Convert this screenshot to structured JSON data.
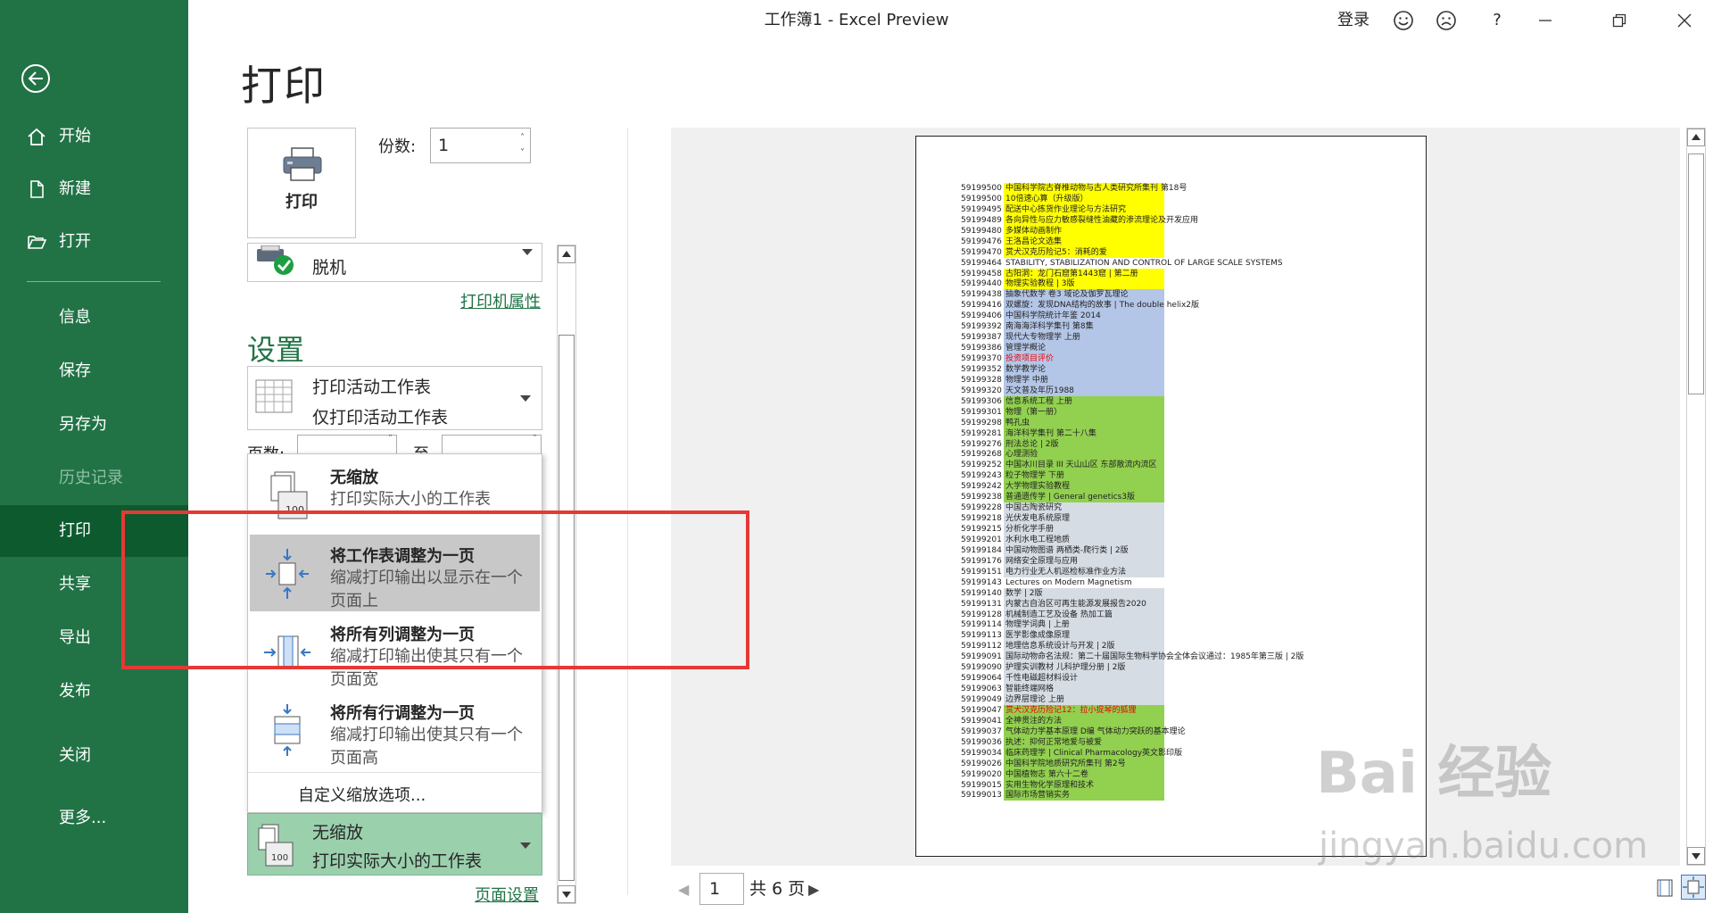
{
  "window": {
    "title": "工作簿1 -  Excel Preview",
    "login": "登录",
    "help": "?"
  },
  "nav": {
    "items": [
      {
        "label": "开始",
        "icon": "home-icon"
      },
      {
        "label": "新建",
        "icon": "new-document-icon"
      },
      {
        "label": "打开",
        "icon": "folder-open-icon"
      },
      {
        "label": "信息"
      },
      {
        "label": "保存"
      },
      {
        "label": "另存为"
      },
      {
        "label": "历史记录",
        "disabled": true
      },
      {
        "label": "打印",
        "active": true
      },
      {
        "label": "共享"
      },
      {
        "label": "导出"
      },
      {
        "label": "发布"
      },
      {
        "label": "关闭"
      },
      {
        "label": "更多..."
      }
    ]
  },
  "print": {
    "heading": "打印",
    "print_button": "打印",
    "copies_label": "份数:",
    "copies_value": "1",
    "printer_name": "脱机",
    "printer_properties": "打印机属性",
    "settings_heading": "设置",
    "what_to_print_title": "打印活动工作表",
    "what_to_print_desc": "仅打印活动工作表",
    "pages_label": "页数:",
    "to_label": "至",
    "scaling_options": [
      {
        "title": "无缩放",
        "desc": "打印实际大小的工作表",
        "icon": "no-scaling-icon"
      },
      {
        "title": "将工作表调整为一页",
        "desc": "缩减打印输出以显示在一个页面上",
        "icon": "fit-sheet-icon",
        "selected": true
      },
      {
        "title": "将所有列调整为一页",
        "desc": "缩减打印输出使其只有一个页面宽",
        "icon": "fit-columns-icon"
      },
      {
        "title": "将所有行调整为一页",
        "desc": "缩减打印输出使其只有一个页面高",
        "icon": "fit-rows-icon"
      }
    ],
    "custom_scaling": "自定义缩放选项...",
    "current_scaling_title": "无缩放",
    "current_scaling_desc": "打印实际大小的工作表",
    "page_setup": "页面设置"
  },
  "preview": {
    "current_page": "1",
    "total_pages": "共 6 页",
    "rows": [
      {
        "id": "59199500",
        "text": "中国科学院古脊椎动物与古人类研究所集刊 第18号",
        "c": "y",
        "red": true
      },
      {
        "id": "59199500",
        "text": "10倍速心算（升级版）",
        "c": "y",
        "red": true
      },
      {
        "id": "59199495",
        "text": "配送中心拣货作业理论与方法研究",
        "c": "y",
        "red": true
      },
      {
        "id": "59199489",
        "text": "各向异性与应力敏感裂缝性油藏的渗流理论及开发应用",
        "c": "y",
        "red": true
      },
      {
        "id": "59199480",
        "text": "多媒体动画制作",
        "c": "y",
        "red": true
      },
      {
        "id": "59199476",
        "text": "王洛昌论文选集",
        "c": "y",
        "red": true
      },
      {
        "id": "59199470",
        "text": "赏犬汉克历险记5：消耗的爱",
        "c": "y",
        "red": true
      },
      {
        "id": "59199464",
        "text": "STABILITY, STABILIZATION AND CONTROL OF LARGE SCALE SYSTEMS",
        "c": "w"
      },
      {
        "id": "59199458",
        "text": "古阳洞：龙门石窟第1443窟 | 第二册",
        "c": "y",
        "red": true
      },
      {
        "id": "59199440",
        "text": "物理实验教程 | 3版",
        "c": "y",
        "red": true
      },
      {
        "id": "59199438",
        "text": "抽象代数学 卷3 域论及伽罗瓦理论",
        "c": "b"
      },
      {
        "id": "59199416",
        "text": "双螺旋：发现DNA结构的故事 | The double helix2版",
        "c": "b"
      },
      {
        "id": "59199406",
        "text": "中国科学院统计年鉴 2014",
        "c": "b"
      },
      {
        "id": "59199392",
        "text": "南海海洋科学集刊 第8集",
        "c": "b"
      },
      {
        "id": "59199387",
        "text": "现代大专物理学 上册",
        "c": "b"
      },
      {
        "id": "59199386",
        "text": "管理学概论",
        "c": "b"
      },
      {
        "id": "59199370",
        "text": "投资项目评价",
        "c": "b",
        "red": true
      },
      {
        "id": "59199352",
        "text": "数学教学论",
        "c": "b"
      },
      {
        "id": "59199328",
        "text": "物理学 中册",
        "c": "b"
      },
      {
        "id": "59199320",
        "text": "天文普及年历1988",
        "c": "b"
      },
      {
        "id": "59199306",
        "text": "信息系统工程 上册",
        "c": "g"
      },
      {
        "id": "59199301",
        "text": "物理（第一册）",
        "c": "g"
      },
      {
        "id": "59199298",
        "text": "鸭孔虫",
        "c": "g"
      },
      {
        "id": "59199281",
        "text": "海洋科学集刊 第二十八集",
        "c": "g"
      },
      {
        "id": "59199276",
        "text": "刑法总论 | 2版",
        "c": "g"
      },
      {
        "id": "59199268",
        "text": "心理测验",
        "c": "g"
      },
      {
        "id": "59199252",
        "text": "中国冰川目录 III 天山山区 东部散流内流区",
        "c": "g"
      },
      {
        "id": "59199243",
        "text": "粒子物理学 下册",
        "c": "g"
      },
      {
        "id": "59199242",
        "text": "大学物理实验教程",
        "c": "g"
      },
      {
        "id": "59199238",
        "text": "普通遗传学 | General genetics3版",
        "c": "g"
      },
      {
        "id": "59199228",
        "text": "中国古陶瓷研究",
        "c": "s"
      },
      {
        "id": "59199218",
        "text": "光伏发电系统原理",
        "c": "s"
      },
      {
        "id": "59199215",
        "text": "分析化学手册",
        "c": "s"
      },
      {
        "id": "59199201",
        "text": "水利水电工程地质",
        "c": "s"
      },
      {
        "id": "59199184",
        "text": "中国动物图谱 两栖类-爬行类 | 2版",
        "c": "s"
      },
      {
        "id": "59199176",
        "text": "网络安全原理与应用",
        "c": "s"
      },
      {
        "id": "59199151",
        "text": "电力行业无人机巡检标准作业方法",
        "c": "s"
      },
      {
        "id": "59199143",
        "text": "Lectures on Modern Magnetism",
        "c": "w"
      },
      {
        "id": "59199140",
        "text": "数学 | 2版",
        "c": "s"
      },
      {
        "id": "59199131",
        "text": "内蒙古自治区可再生能源发展报告2020",
        "c": "s"
      },
      {
        "id": "59199128",
        "text": "机械制造工艺及设备 热加工篇",
        "c": "s"
      },
      {
        "id": "59199114",
        "text": "物理学词典 | 上册",
        "c": "s"
      },
      {
        "id": "59199113",
        "text": "医学影像成像原理",
        "c": "s"
      },
      {
        "id": "59199112",
        "text": "地理信息系统设计与开发 | 2版",
        "c": "s"
      },
      {
        "id": "59199091",
        "text": "国际动物命名法规：第二十届国际生物科学协会全体会议通过：1985年第三版 | 2版",
        "c": "s"
      },
      {
        "id": "59199090",
        "text": "护理实训教材 儿科护理分册 | 2版",
        "c": "s"
      },
      {
        "id": "59199064",
        "text": "千性电磁超材料设计",
        "c": "s"
      },
      {
        "id": "59199063",
        "text": "智能终端网格",
        "c": "s"
      },
      {
        "id": "59199049",
        "text": "边界层理论 上册",
        "c": "s"
      },
      {
        "id": "59199047",
        "text": "赏犬汉克历险记12：拉小提琴的狐狸",
        "c": "g",
        "red": true
      },
      {
        "id": "59199041",
        "text": "全神贯注的方法",
        "c": "g"
      },
      {
        "id": "59199037",
        "text": "气体动力学基本原理 D编 气体动力突跃的基本理论",
        "c": "g"
      },
      {
        "id": "59199036",
        "text": "执述：抑何正常地爱与被爱",
        "c": "g"
      },
      {
        "id": "59199034",
        "text": "临床药理学 | Clinical Pharmacology英文影印版",
        "c": "g"
      },
      {
        "id": "59199026",
        "text": "中国科学院地质研究所集刊 第2号",
        "c": "g"
      },
      {
        "id": "59199020",
        "text": "中国植物志 第六十二卷",
        "c": "g"
      },
      {
        "id": "59199015",
        "text": "实用生物化学原理和技术",
        "c": "g"
      },
      {
        "id": "59199013",
        "text": "国际市场营销实务",
        "c": "g"
      }
    ]
  },
  "colors": {
    "y": "#ffff00",
    "b": "#b4c6e7",
    "g": "#92d050",
    "s": "#d6dce4",
    "w": "#ffffff",
    "accent": "#217346"
  },
  "watermark": {
    "line1": "Bai 经验",
    "line2": "jingyan.baidu.com"
  }
}
